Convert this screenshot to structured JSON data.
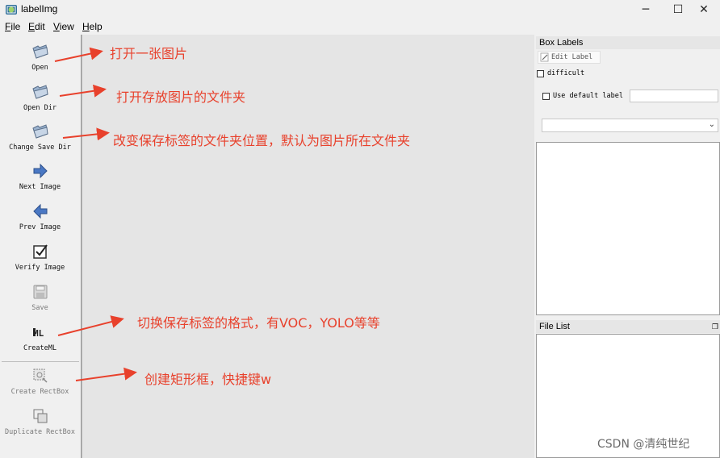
{
  "window": {
    "title": "labelImg",
    "minimize_glyph": "─",
    "maximize_glyph": "☐",
    "close_glyph": "✕"
  },
  "menu": [
    {
      "accel": "F",
      "rest": "ile"
    },
    {
      "accel": "E",
      "rest": "dit"
    },
    {
      "accel": "V",
      "rest": "iew"
    },
    {
      "accel": "H",
      "rest": "elp"
    }
  ],
  "toolbar": {
    "open": "Open",
    "open_dir": "Open Dir",
    "change_save_dir": "Change Save Dir",
    "next_image": "Next Image",
    "prev_image": "Prev Image",
    "verify_image": "Verify Image",
    "save": "Save",
    "createml": "CreateML",
    "create_rectbox": "Create RectBox",
    "duplicate_rectbox": "Duplicate RectBox"
  },
  "box_labels": {
    "title": "Box Labels",
    "edit_label": "Edit Label",
    "difficult": "difficult",
    "use_default_label": "Use default label",
    "default_label_value": "",
    "label_combo_value": ""
  },
  "file_list": {
    "title": "File List"
  },
  "annotations": {
    "open": "打开一张图片",
    "open_dir": "打开存放图片的文件夹",
    "change_save_dir": "改变保存标签的文件夹位置，默认为图片所在文件夹",
    "createml": "切换保存标签的格式，有VOC，YOLO等等",
    "create_rectbox": "创建矩形框，快捷键w"
  },
  "watermark": "CSDN @清纯世纪",
  "colors": {
    "annotation": "#e8412c",
    "folder_icon": "#8faac9",
    "arrow_icon": "#4a78c4"
  }
}
